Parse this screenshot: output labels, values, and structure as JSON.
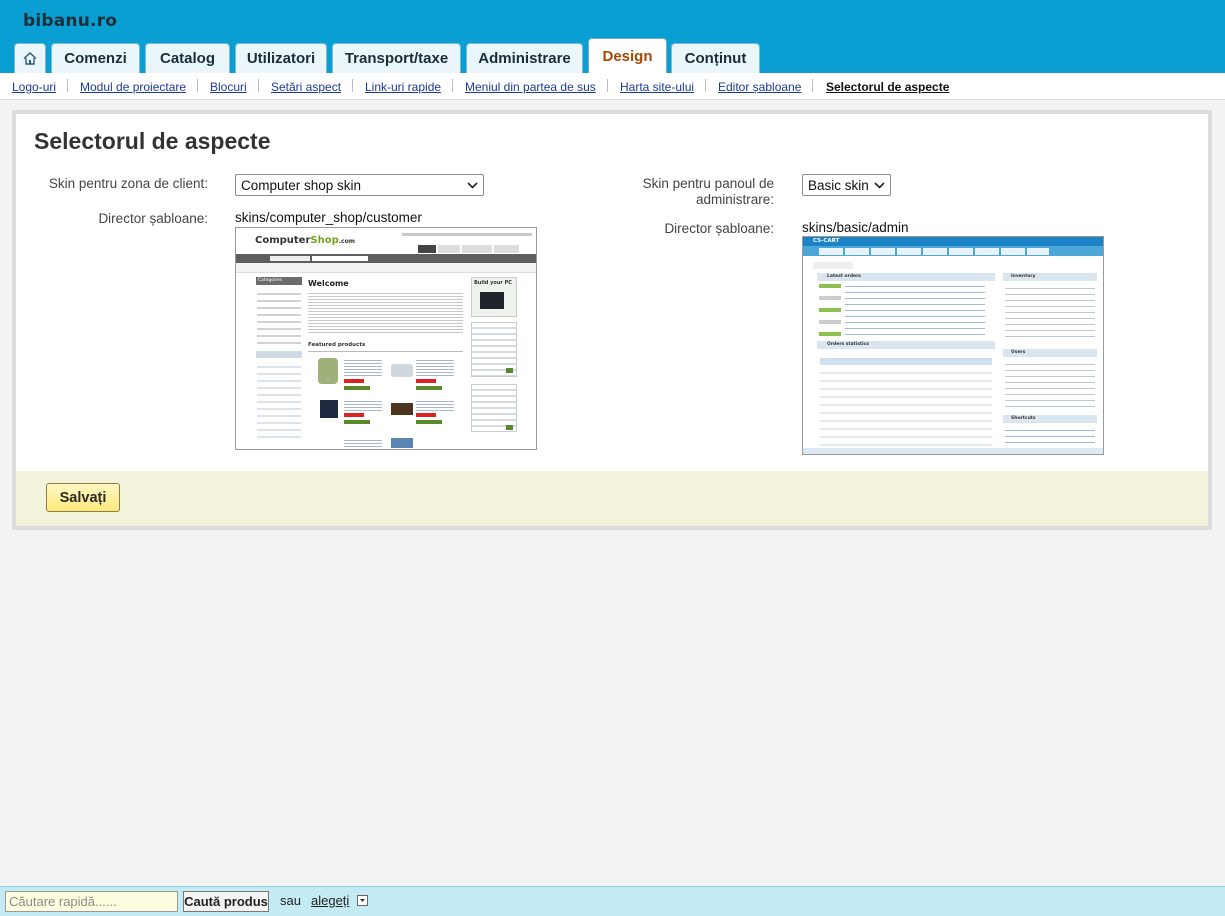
{
  "brand": "bibanu.ro",
  "tabs": [
    {
      "label": "Comenzi"
    },
    {
      "label": "Catalog"
    },
    {
      "label": "Utilizatori"
    },
    {
      "label": "Transport/taxe"
    },
    {
      "label": "Administrare"
    },
    {
      "label": "Design",
      "active": true
    },
    {
      "label": "Conținut"
    }
  ],
  "subnav": [
    {
      "label": "Logo-uri"
    },
    {
      "label": "Modul de proiectare"
    },
    {
      "label": "Blocuri"
    },
    {
      "label": "Setări aspect"
    },
    {
      "label": "Link-uri rapide"
    },
    {
      "label": "Meniul din partea de sus"
    },
    {
      "label": "Harta site-ului"
    },
    {
      "label": "Editor șabloane"
    },
    {
      "label": "Selectorul de aspecte",
      "current": true
    }
  ],
  "page": {
    "title": "Selectorul de aspecte",
    "client": {
      "skin_label": "Skin pentru zona de client:",
      "skin_value": "Computer shop skin",
      "dir_label": "Director șabloane:",
      "dir_value": "skins/computer_shop/customer",
      "thumb": {
        "logo_a": "Computer",
        "logo_b": "Shop",
        "logo_c": ".com",
        "welcome": "Welcome",
        "featured": "Featured products",
        "categories": "Categories",
        "build": "Build your PC"
      }
    },
    "admin": {
      "skin_label_1": "Skin pentru panoul de",
      "skin_label_2": "administrare:",
      "skin_value": "Basic skin",
      "dir_label": "Director șabloane:",
      "dir_value": "skins/basic/admin",
      "thumb": {
        "logo": "CS-CART",
        "latest_orders": "Latest orders",
        "order_stats": "Orders statistics",
        "inventory": "Inventory",
        "users": "Users",
        "shortcuts": "Shortcuts"
      }
    },
    "save_label": "Salvați"
  },
  "quicksearch": {
    "placeholder": "Căutare rapidă......",
    "button": "Caută produs",
    "or": "sau",
    "choose": "alegeți"
  },
  "colors": {
    "topbar": "#099fd2",
    "active_tab_text": "#a04a05",
    "link": "#1c3a9b",
    "save_bg": "#fde97c",
    "footer_bg": "#f3f3dc",
    "bottombar": "#c4ebf3"
  }
}
